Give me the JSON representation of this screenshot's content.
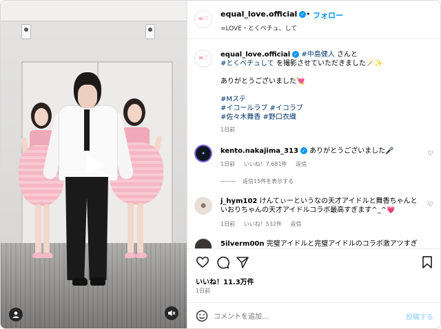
{
  "header": {
    "username": "equal_love.official",
    "separator": "•",
    "follow_label": "フォロー",
    "subtitle": "=LOVE・とくベチュ、して",
    "more_icon": "more-horizontal-icon"
  },
  "caption": {
    "username": "equal_love.official",
    "line1_mention": "#中島健人",
    "line1_suffix": " さんと",
    "line2_tag": "#とくベチュして",
    "line2_text": " を撮影させていただきました🪄✨",
    "line3": "ありがとうございました💘",
    "hashtags": [
      "#Mステ",
      "#イコールラブ #イコラブ",
      "#佐々木舞香 #野口衣織"
    ],
    "time": "1日前"
  },
  "comments": [
    {
      "username": "kento.nakajima_313",
      "verified": true,
      "text": "ありがとうございました🎤",
      "time": "1日前",
      "likes": "いいね！7,681件",
      "reply": "返信",
      "view_replies": "返信15件を表示する"
    },
    {
      "username": "j_hym102",
      "verified": false,
      "text_line1": "けんてぃーというなの天才アイドルと舞香ちゃんと",
      "text_line2": "いおりちゃんの天才アイドルコラボ最高すぎます^_^💗",
      "time": "1日前",
      "likes": "いいね！532件",
      "reply": "返信"
    },
    {
      "username": "5ilverm00n",
      "verified": false,
      "text": "完璧アイドルと完璧アイドルのコラボ激アツすぎ"
    }
  ],
  "actions": {
    "like_icon": "heart-icon",
    "comment_icon": "comment-icon",
    "share_icon": "send-icon",
    "save_icon": "bookmark-icon",
    "likes": "いいね！11.3万件",
    "time": "1日前"
  },
  "comment_bar": {
    "emoji_icon": "emoji-icon",
    "placeholder": "コメントを追加...",
    "post_label": "投稿する"
  },
  "media": {
    "play_icon": "play-icon",
    "user_tag_icon": "user-tag-icon",
    "mute_icon": "mute-icon"
  },
  "colors": {
    "accent": "#0095f6",
    "link": "#00376b",
    "muted": "#737373",
    "post_disabled": "#b2dffc"
  }
}
